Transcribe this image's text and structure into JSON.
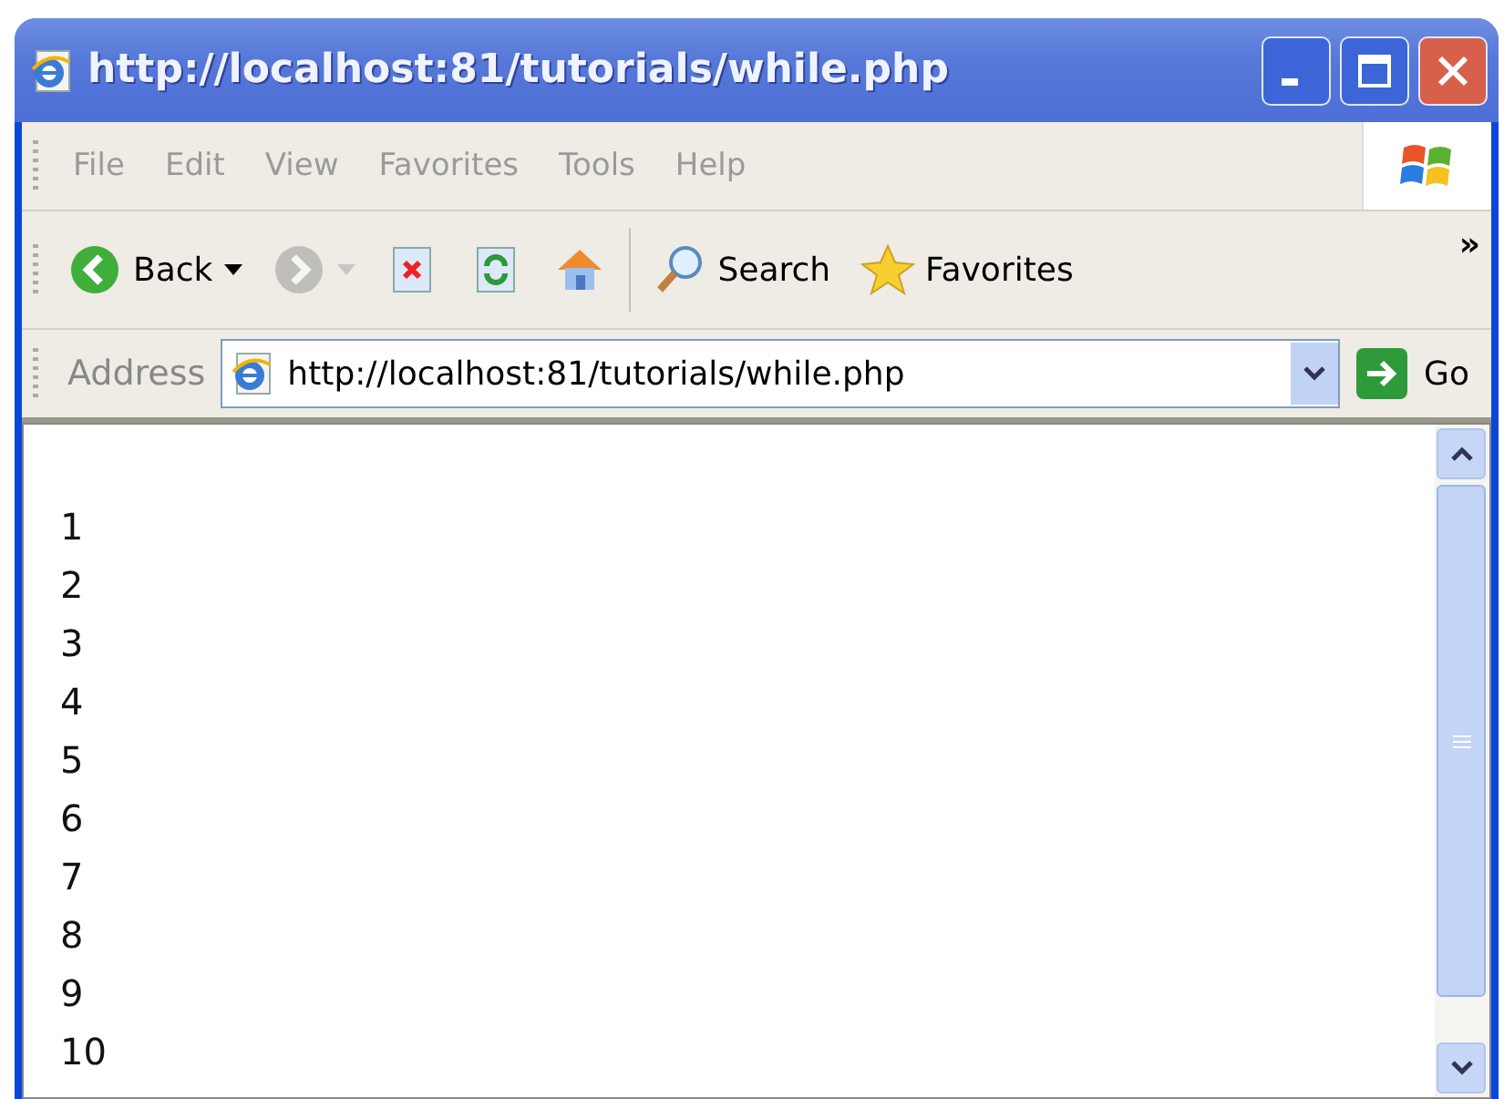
{
  "window": {
    "title": "http://localhost:81/tutorials/while.php"
  },
  "menu": [
    "File",
    "Edit",
    "View",
    "Favorites",
    "Tools",
    "Help"
  ],
  "toolbar": [
    {
      "kind": "back",
      "label": "Back",
      "disabled": false
    },
    {
      "kind": "forward",
      "disabled": true
    },
    {
      "kind": "stop",
      "disabled": false
    },
    {
      "kind": "refresh",
      "disabled": false
    },
    {
      "kind": "home",
      "disabled": false
    },
    {
      "kind": "separator"
    },
    {
      "kind": "search",
      "label": "Search",
      "disabled": false
    },
    {
      "kind": "favorites",
      "label": "Favorites",
      "disabled": false
    }
  ],
  "toolbar_more": "»",
  "address": {
    "label": "Address",
    "value": "http://localhost:81/tutorials/while.php",
    "go": "Go"
  },
  "content": {
    "lines": [
      "1",
      "2",
      "3",
      "4",
      "5",
      "6",
      "7",
      "8",
      "9",
      "10"
    ]
  }
}
